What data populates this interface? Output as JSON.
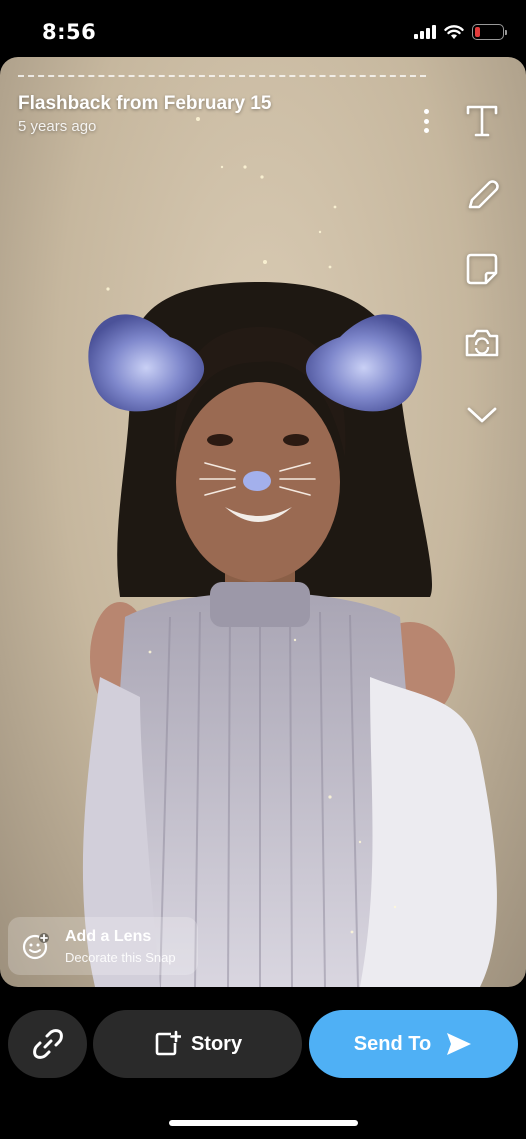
{
  "status_bar": {
    "time": "8:56",
    "icons": [
      "signal-icon",
      "wifi-icon",
      "battery-icon"
    ],
    "battery_level": 0.15,
    "battery_color": "#e23b3b"
  },
  "snap": {
    "flashback_title": "Flashback from February 15",
    "flashback_subtitle": "5 years ago",
    "tools": [
      "text-icon",
      "pencil-icon",
      "sticker-icon",
      "camera-flip-icon",
      "chevron-down-icon"
    ],
    "lens": {
      "title": "Add a Lens",
      "subtitle": "Decorate this Snap"
    }
  },
  "bottom_bar": {
    "link_icon": "link-icon",
    "story_label": "Story",
    "send_label": "Send To",
    "send_color": "#4fb0f5"
  }
}
